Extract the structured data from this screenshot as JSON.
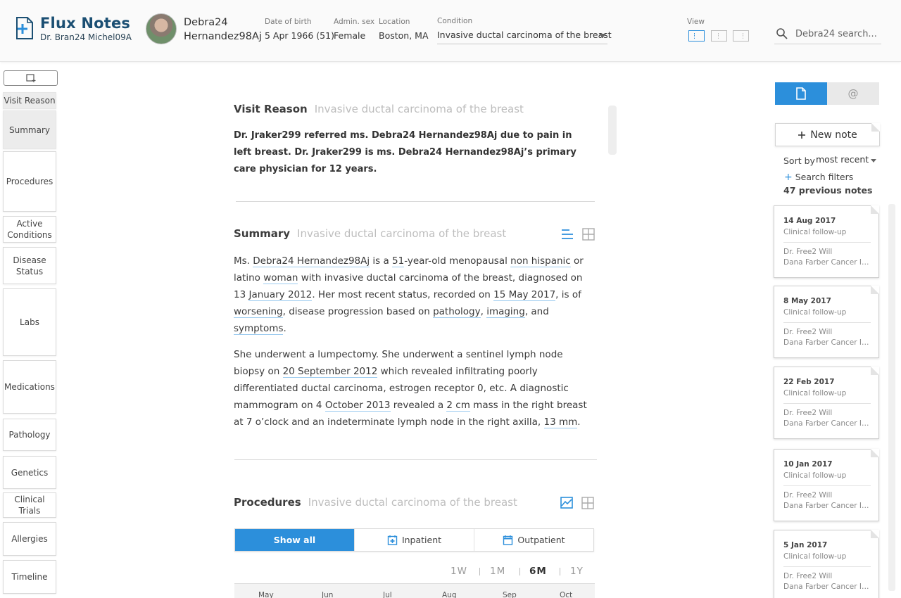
{
  "app": {
    "title": "Flux Notes",
    "user": "Dr. Bran24 Michel09A"
  },
  "patient": {
    "first_name": "Debra24",
    "last_name": "Hernandez98Aj",
    "dob_label": "Date of birth",
    "dob_value": "5 Apr 1966 (51)",
    "sex_label": "Admin. sex",
    "sex_value": "Female",
    "location_label": "Location",
    "location_value": "Boston, MA",
    "condition_label": "Condition",
    "condition_value": "Invasive ductal carcinoma of the breast"
  },
  "view": {
    "label": "View",
    "options": [
      "view-layout-left-icon",
      "view-layout-center-icon",
      "view-layout-right-icon"
    ],
    "active_index": 0
  },
  "search": {
    "placeholder": "Debra24 search..."
  },
  "nav": {
    "items": [
      "Visit Reason",
      "Summary",
      "Procedures",
      "Active Conditions",
      "Disease Status",
      "Labs",
      "Medications",
      "Pathology",
      "Genetics",
      "Clinical Trials",
      "Allergies",
      "Timeline"
    ],
    "active": [
      "Visit Reason",
      "Summary"
    ]
  },
  "visit_reason": {
    "heading": "Visit Reason",
    "subheading": "Invasive ductal carcinoma of the breast",
    "text": "Dr. Jraker299 referred ms. Debra24 Hernandez98Aj due to pain in left breast. Dr. Jraker299 is ms. Debra24 Hernandez98Aj’s primary care physician for 12 years."
  },
  "summary": {
    "heading": "Summary",
    "subheading": "Invasive ductal carcinoma of the breast",
    "p1": {
      "t1": "Ms. ",
      "name": "Debra24 Hernandez98Aj",
      "t2": " is a ",
      "age": "51",
      "t3": "-year-old menopausal ",
      "ethnicity": "non hispanic",
      "t4": " or latino ",
      "gender": "woman",
      "t5": " with invasive ductal carcinoma of the breast, diagnosed on 13 ",
      "diag_date": "January 2012",
      "t6": ".  Her most recent status, recorded on ",
      "status_date": "15 May 2017",
      "t7": ", is of ",
      "status": "worsening",
      "t8": ", disease progression based on ",
      "basis1": "pathology",
      "t9": ", ",
      "basis2": "imaging",
      "t10": ", and ",
      "basis3": "symptoms",
      "t11": "."
    },
    "p2": {
      "t1": "She underwent a lumpectomy. She underwent a sentinel lymph node biopsy on ",
      "biopsy_date": "20 September 2012",
      "t2": " which revealed infiltrating poorly differentiated ductal carcinoma, estrogen receptor 0, etc. A diagnostic mammogram on 4 ",
      "mammo_date": "October 2013",
      "t3": " revealed a ",
      "mass_size": "2 cm",
      "t4": " mass in the right breast at 7 o’clock and an indeterminate lymph node in the right axilla, ",
      "node_size": "13 mm",
      "t5": "."
    }
  },
  "procedures": {
    "heading": "Procedures",
    "subheading": "Invasive ductal carcinoma of the breast",
    "filters": [
      "Show all",
      "Inpatient",
      "Outpatient"
    ],
    "active_filter": "Show all",
    "ranges": [
      "1W",
      "1M",
      "6M",
      "1Y"
    ],
    "active_range": "6M",
    "months": [
      "May",
      "Jun",
      "Jul",
      "Aug",
      "Sep",
      "Oct"
    ]
  },
  "notes_panel": {
    "tab_icons": [
      "note-icon",
      "at-sign-icon"
    ],
    "at_tab_label": "@",
    "new_note_label": "New note",
    "sort_label": "Sort by",
    "sort_value": "most recent",
    "filters_label": "Search filters",
    "count_label": "47 previous notes",
    "notes": [
      {
        "date": "14 Aug 2017",
        "type": "Clinical follow-up",
        "author": "Dr. Free2 Will",
        "org": "Dana Farber Cancer Institute"
      },
      {
        "date": "8 May 2017",
        "type": "Clinical follow-up",
        "author": "Dr. Free2 Will",
        "org": "Dana Farber Cancer Institute"
      },
      {
        "date": "22 Feb 2017",
        "type": "Clinical follow-up",
        "author": "Dr. Free2 Will",
        "org": "Dana Farber Cancer Institute"
      },
      {
        "date": "10 Jan 2017",
        "type": "Clinical follow-up",
        "author": "Dr. Free2 Will",
        "org": "Dana Farber Cancer Institute"
      },
      {
        "date": "5 Jan 2017",
        "type": "Clinical follow-up",
        "author": "Dr. Free2 Will",
        "org": "Dana Farber Cancer Institute"
      }
    ]
  },
  "colors": {
    "accent": "#2c8fdb",
    "brand": "#1b4f73",
    "underline": "#9ccbef"
  }
}
